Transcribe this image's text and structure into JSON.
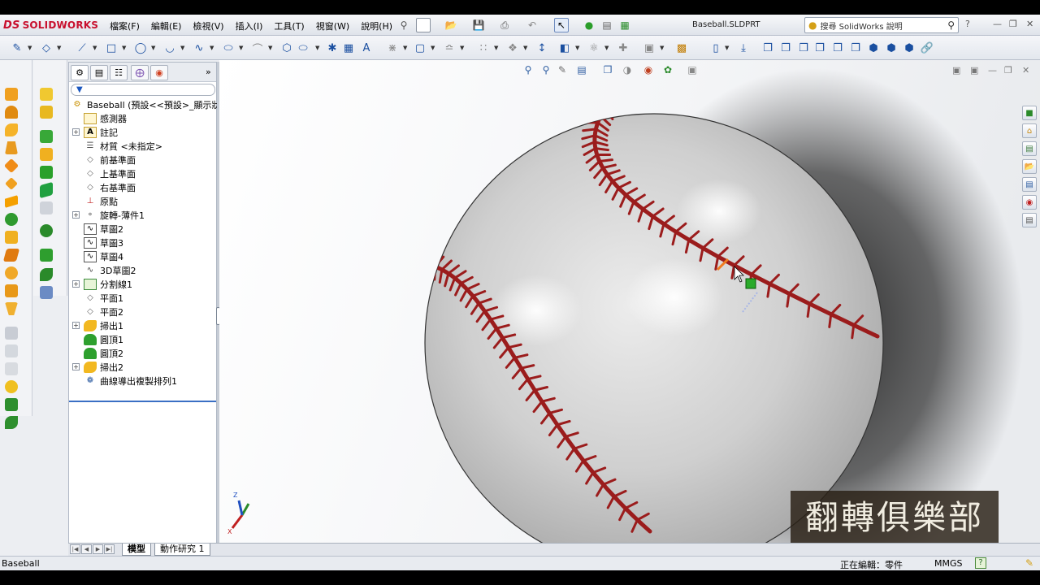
{
  "app": {
    "logo_text": "SOLIDWORKS",
    "logo_mark": "DS",
    "document_title": "Baseball.SLDPRT",
    "menus": [
      "檔案(F)",
      "編輯(E)",
      "檢視(V)",
      "插入(I)",
      "工具(T)",
      "視窗(W)",
      "說明(H)"
    ],
    "search_placeholder": "搜尋 SolidWorks 說明",
    "help_label": "?"
  },
  "feature_tree": {
    "filter_icon": "filter-icon",
    "root_label": "Baseball  (預設<<預設>_顯示狀",
    "items": [
      {
        "label": "感測器",
        "icon": "sensor-icon",
        "expandable": false
      },
      {
        "label": "註記",
        "icon": "annotation-icon",
        "expandable": true
      },
      {
        "label": "材質 <未指定>",
        "icon": "material-icon",
        "expandable": false
      },
      {
        "label": "前基準面",
        "icon": "plane-icon",
        "expandable": false
      },
      {
        "label": "上基準面",
        "icon": "plane-icon",
        "expandable": false
      },
      {
        "label": "右基準面",
        "icon": "plane-icon",
        "expandable": false
      },
      {
        "label": "原點",
        "icon": "origin-icon",
        "expandable": false
      },
      {
        "label": "旋轉-薄件1",
        "icon": "revolve-icon",
        "expandable": true
      },
      {
        "label": "草圖2",
        "icon": "sketch-icon",
        "expandable": false
      },
      {
        "label": "草圖3",
        "icon": "sketch-icon",
        "expandable": false
      },
      {
        "label": "草圖4",
        "icon": "sketch-icon",
        "expandable": false
      },
      {
        "label": "3D草圖2",
        "icon": "sketch3d-icon",
        "expandable": false
      },
      {
        "label": "分割線1",
        "icon": "split-line-icon",
        "expandable": true
      },
      {
        "label": "平面1",
        "icon": "plane-icon",
        "expandable": false
      },
      {
        "label": "平面2",
        "icon": "plane-icon",
        "expandable": false
      },
      {
        "label": "掃出1",
        "icon": "sweep-icon",
        "expandable": true
      },
      {
        "label": "圓頂1",
        "icon": "dome-icon",
        "expandable": false
      },
      {
        "label": "圓頂2",
        "icon": "dome-icon",
        "expandable": false
      },
      {
        "label": "掃出2",
        "icon": "sweep-icon",
        "expandable": true
      },
      {
        "label": "曲線導出複製排列1",
        "icon": "curve-pattern-icon",
        "expandable": false
      }
    ]
  },
  "bottom_tabs": {
    "model": "模型",
    "motion_study": "動作研究 1"
  },
  "status": {
    "left": "Baseball",
    "editing": "正在編輯：零件",
    "units": "MMGS",
    "help": "?"
  },
  "viewport": {
    "watermark": "翻轉俱樂部",
    "triad_z": "Z",
    "triad_x": "X",
    "ball_color": "#d8d8d8",
    "seam_color": "#9b1c1c"
  },
  "colors": {
    "accent_red": "#c8102e",
    "tree_selection": "#3a6fc4"
  }
}
